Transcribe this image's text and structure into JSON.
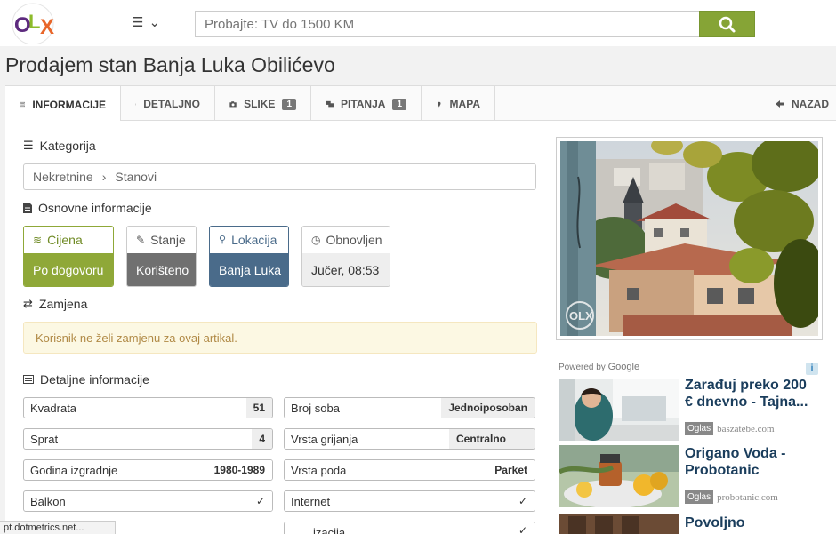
{
  "header": {
    "logo_text": "OLX",
    "search_placeholder": "Probajte: TV do 1500 KM"
  },
  "page_title": "Prodajem stan Banja Luka Obilićevo",
  "tabs": [
    {
      "label": "INFORMACIJE",
      "icon": "list-icon",
      "active": true
    },
    {
      "label": "DETALJNO",
      "icon": "document-icon"
    },
    {
      "label": "SLIKE",
      "icon": "camera-icon",
      "badge": "1"
    },
    {
      "label": "PITANJA",
      "icon": "chat-icon",
      "badge": "1"
    },
    {
      "label": "MAPA",
      "icon": "map-pin-icon"
    }
  ],
  "back_label": "NAZAD",
  "kategorija": {
    "heading": "Kategorija",
    "crumbs": [
      "Nekretnine",
      "Stanovi"
    ],
    "separator": "›"
  },
  "osnovne": {
    "heading": "Osnovne informacije",
    "cards": [
      {
        "label": "Cijena",
        "value": "Po dogovoru",
        "color": "#8fa838",
        "icon": "money-icon"
      },
      {
        "label": "Stanje",
        "value": "Korišteno",
        "color": "#707070",
        "icon": "tag-icon"
      },
      {
        "label": "Lokacija",
        "value": "Banja Luka",
        "color": "#4a6b8a",
        "icon": "map-pin-icon"
      },
      {
        "label": "Obnovljen",
        "value": "Jučer, 08:53",
        "color": "#eeeeee",
        "icon": "clock-icon"
      }
    ]
  },
  "zamjena": {
    "heading": "Zamjena",
    "notice": "Korisnik ne želi zamjenu za ovaj artikal."
  },
  "detaljne": {
    "heading": "Detaljne informacije",
    "left": [
      {
        "label": "Kvadrata",
        "value": "51"
      },
      {
        "label": "Sprat",
        "value": "4"
      },
      {
        "label": "Godina izgradnje",
        "value": "1980-1989"
      },
      {
        "label": "Balkon",
        "value": "✓"
      }
    ],
    "right": [
      {
        "label": "Broj soba",
        "value": "Jednoiposoban"
      },
      {
        "label": "Vrsta grijanja",
        "value": "Centralno"
      },
      {
        "label": "Vrsta poda",
        "value": "Parket"
      },
      {
        "label": "Internet",
        "value": "✓"
      }
    ],
    "partial_right_label": "izacija",
    "partial_right_value": "✓"
  },
  "photo_watermark": "OLX",
  "ads": {
    "powered_by": "Powered by",
    "google": "Google",
    "info_icon": "i",
    "items": [
      {
        "title": "Zarađuj preko 200 € dnevno - Tajna...",
        "tag": "Oglas",
        "source": "baszatebe.com"
      },
      {
        "title": "Origano Voda - Probotanic",
        "tag": "Oglas",
        "source": "probotanic.com"
      },
      {
        "title": "Povoljno",
        "tag": "",
        "source": ""
      }
    ]
  },
  "status_bar": "pt.dotmetrics.net..."
}
